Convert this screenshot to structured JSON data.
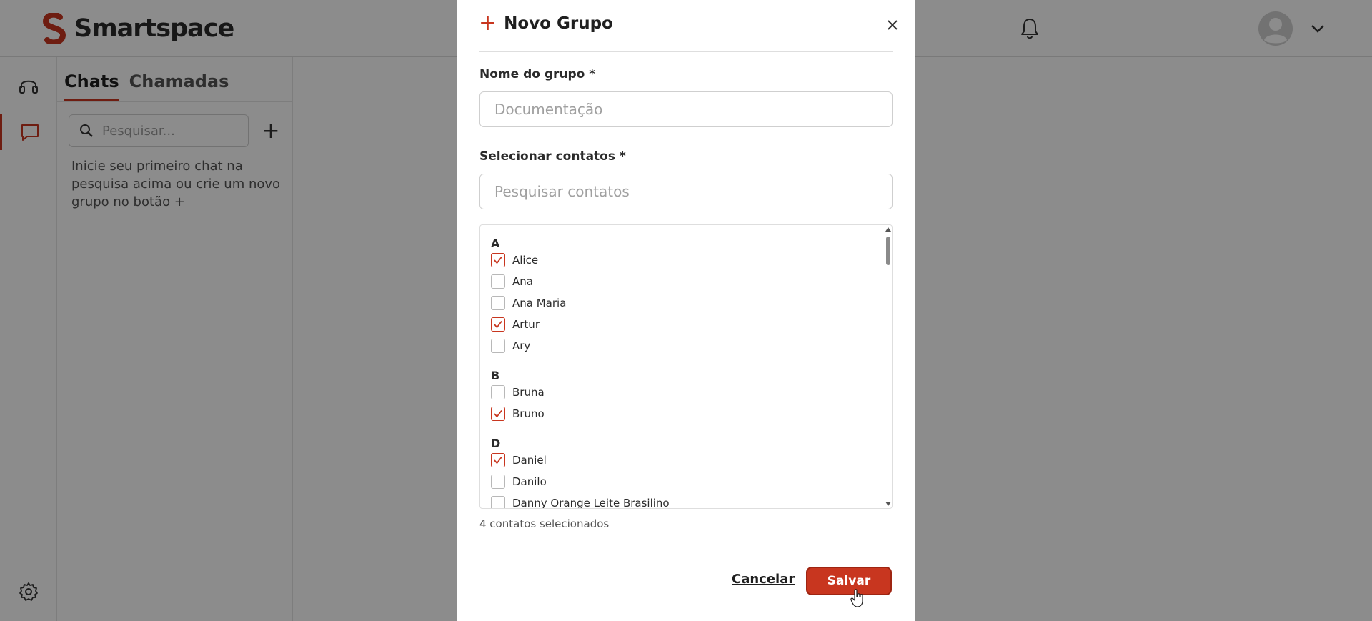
{
  "app": {
    "brand": "Smartspace"
  },
  "header": {
    "bell_icon": "bell-icon",
    "avatar_icon": "user-avatar-icon",
    "menu_icon": "chevron-down-icon"
  },
  "rail": {
    "items": [
      "headset-icon",
      "chat-icon"
    ],
    "bottom": "gear-icon"
  },
  "panel": {
    "tabs": [
      {
        "label": "Chats",
        "active": true
      },
      {
        "label": "Chamadas",
        "active": false
      }
    ],
    "search_placeholder": "Pesquisar...",
    "add_symbol": "+",
    "empty_hint": "Inicie seu primeiro chat na pesquisa acima ou crie um novo grupo no botão +"
  },
  "modal": {
    "title_icon": "+",
    "title": "Novo Grupo",
    "group_name_label": "Nome do grupo *",
    "group_name_placeholder": "Documentação",
    "contacts_label": "Selecionar contatos *",
    "contacts_placeholder": "Pesquisar contatos",
    "groups": [
      {
        "letter": "A",
        "contacts": [
          {
            "name": "Alice",
            "checked": true
          },
          {
            "name": "Ana",
            "checked": false
          },
          {
            "name": "Ana Maria",
            "checked": false
          },
          {
            "name": "Artur",
            "checked": true
          },
          {
            "name": "Ary",
            "checked": false
          }
        ]
      },
      {
        "letter": "B",
        "contacts": [
          {
            "name": "Bruna",
            "checked": false
          },
          {
            "name": "Bruno",
            "checked": true
          }
        ]
      },
      {
        "letter": "D",
        "contacts": [
          {
            "name": "Daniel",
            "checked": true
          },
          {
            "name": "Danilo",
            "checked": false
          },
          {
            "name": "Danny Orange Leite Brasilino",
            "checked": false
          }
        ]
      }
    ],
    "selected_count": "4 contatos selecionados",
    "cancel_label": "Cancelar",
    "save_label": "Salvar"
  },
  "colors": {
    "accent": "#c8361f",
    "overlay": "rgba(0,0,0,0.45)"
  }
}
